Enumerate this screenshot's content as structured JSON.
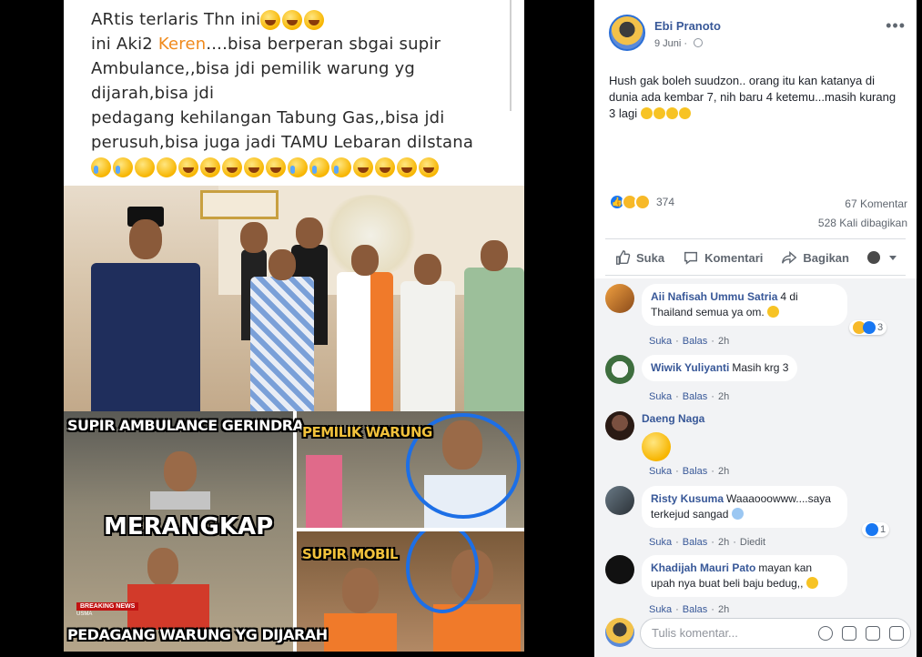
{
  "image_caption": {
    "line1": "ARtis terlaris Thn ini",
    "line2_prefix": "ini Aki2 ",
    "line2_highlight": "Keren",
    "line2_suffix": "....bisa berperan sbgai supir",
    "line3": "Ambulance,,bisa jdi pemilik warung yg",
    "line4": "dijarah,bisa jdi",
    "line5": "pedagang kehilangan Tabung Gas,,bisa jdi",
    "line6": "perusuh,bisa juga jadi TAMU Lebaran diIstana"
  },
  "image_labels": {
    "supir_ambulance": "SUPIR AMBULANCE GERINDRA",
    "pemilik_warung": "PEMILIK WARUNG",
    "merangkap": "MERANGKAP",
    "supir_mobil": "SUPIR MOBIL",
    "pedagang": "PEDAGANG WARUNG YG DIJARAH",
    "breaking_news": "BREAKING NEWS",
    "breaking_sub": "USMA"
  },
  "post": {
    "author": "Ebi Pranoto",
    "date": "9 Juni",
    "more_icon": "more-horizontal-icon",
    "text": "Hush gak boleh suudzon.. orang itu kan katanya di dunia ada kembar 7, nih baru 4 ketemu...masih kurang 3 lagi",
    "reaction_count": "374",
    "comment_count": "67 Komentar",
    "share_count": "528 Kali dibagikan"
  },
  "actions": {
    "like": "Suka",
    "comment": "Komentari",
    "share": "Bagikan"
  },
  "comments": [
    {
      "name": "Aii Nafisah Ummu Satria",
      "text": "4 di Thailand semua ya om.",
      "like": "Suka",
      "reply": "Balas",
      "time": "2h",
      "reactions": "3"
    },
    {
      "name": "Wiwik Yuliyanti",
      "text": "Masih krg 3",
      "like": "Suka",
      "reply": "Balas",
      "time": "2h"
    },
    {
      "name": "Daeng Naga",
      "text": "",
      "like": "Suka",
      "reply": "Balas",
      "time": "2h"
    },
    {
      "name": "Risty Kusuma",
      "text": "Waaaooowww....saya terkejud sangad",
      "like": "Suka",
      "reply": "Balas",
      "time": "2h",
      "edited": "Diedit",
      "reactions": "1"
    },
    {
      "name": "Khadijah Mauri Pato",
      "text": "mayan kan upah nya buat beli baju bedug,,",
      "like": "Suka",
      "reply": "Balas",
      "time": "2h"
    }
  ],
  "composer": {
    "placeholder": "Tulis komentar..."
  },
  "colors": {
    "fb_link": "#385898",
    "fb_blue": "#1877f2",
    "caption_orange": "#f08a1c",
    "overlay_ring": "#1d6fe6"
  }
}
